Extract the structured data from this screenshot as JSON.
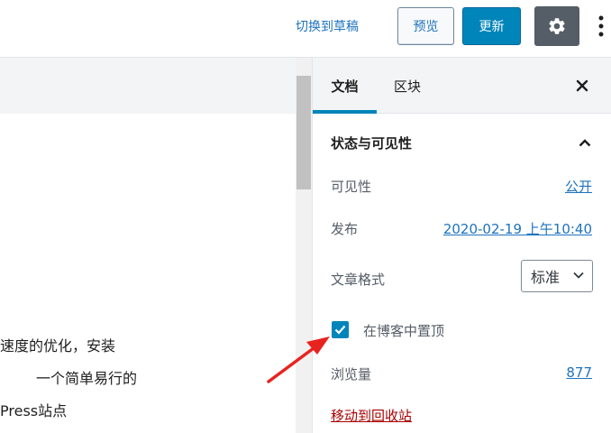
{
  "toolbar": {
    "switch_to_draft": "切换到草稿",
    "preview": "预览",
    "update": "更新",
    "settings_icon": "gear-icon",
    "more_icon": "vertical-ellipsis-icon"
  },
  "editor": {
    "lines": [
      "速度的优化，安装",
      "一个简单易行的",
      "Press站点"
    ]
  },
  "sidebar": {
    "tabs": [
      {
        "label": "文档",
        "active": true
      },
      {
        "label": "区块",
        "active": false
      }
    ],
    "close_icon": "close-icon",
    "panel": {
      "title": "状态与可见性",
      "visibility_label": "可见性",
      "visibility_value": "公开",
      "publish_label": "发布",
      "publish_value": "2020-02-19 上午10:40",
      "format_label": "文章格式",
      "format_value": "标准",
      "sticky_label": "在博客中置顶",
      "sticky_checked": true,
      "views_label": "浏览量",
      "views_value": "877",
      "trash_label": "移动到回收站"
    }
  },
  "colors": {
    "accent": "#0085ba",
    "link": "#1e73be",
    "danger": "#a00",
    "annotation": "#e8231f"
  }
}
